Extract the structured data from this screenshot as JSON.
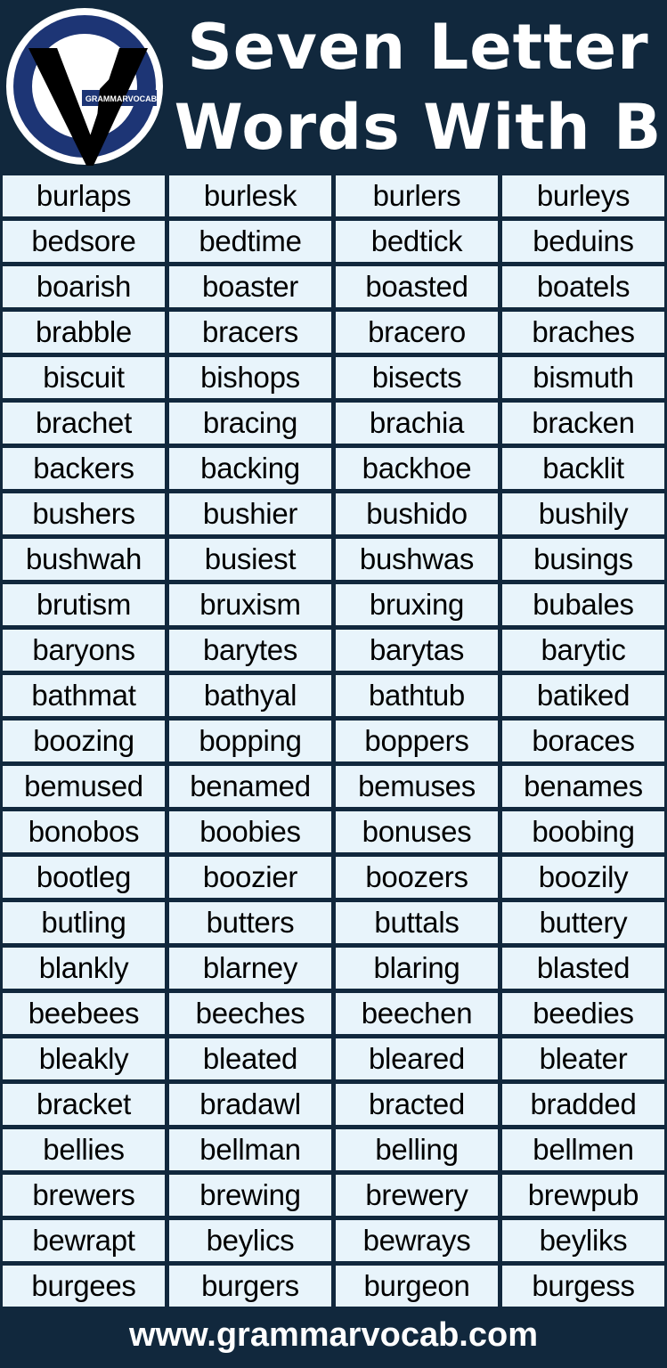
{
  "logo": {
    "text": "GRAMMARVOCAB",
    "colors": {
      "ring": "#1d3575",
      "v": "#000000",
      "bg": "#ffffff"
    }
  },
  "title": {
    "line1": "Seven Letter",
    "line2": "Words With B"
  },
  "colors": {
    "background": "#11283d",
    "cell": "#e8f4fb"
  },
  "words": [
    [
      "burlaps",
      "burlesk",
      "burlers",
      "burleys"
    ],
    [
      "bedsore",
      "bedtime",
      "bedtick",
      "beduins"
    ],
    [
      "boarish",
      "boaster",
      "boasted",
      "boatels"
    ],
    [
      "brabble",
      "bracers",
      "bracero",
      "braches"
    ],
    [
      "biscuit",
      "bishops",
      "bisects",
      "bismuth"
    ],
    [
      "brachet",
      "bracing",
      "brachia",
      "bracken"
    ],
    [
      "backers",
      "backing",
      "backhoe",
      "backlit"
    ],
    [
      "bushers",
      "bushier",
      "bushido",
      "bushily"
    ],
    [
      "bushwah",
      "busiest",
      "bushwas",
      "busings"
    ],
    [
      "brutism",
      "bruxism",
      "bruxing",
      "bubales"
    ],
    [
      "baryons",
      "barytes",
      "barytas",
      "barytic"
    ],
    [
      "bathmat",
      "bathyal",
      "bathtub",
      "batiked"
    ],
    [
      "boozing",
      "bopping",
      "boppers",
      "boraces"
    ],
    [
      "bemused",
      "benamed",
      "bemuses",
      "benames"
    ],
    [
      "bonobos",
      "boobies",
      "bonuses",
      "boobing"
    ],
    [
      "bootleg",
      "boozier",
      "boozers",
      "boozily"
    ],
    [
      "butling",
      "butters",
      "buttals",
      "buttery"
    ],
    [
      "blankly",
      "blarney",
      "blaring",
      "blasted"
    ],
    [
      "beebees",
      "beeches",
      "beechen",
      "beedies"
    ],
    [
      "bleakly",
      "bleated",
      "bleared",
      "bleater"
    ],
    [
      "bracket",
      "bradawl",
      "bracted",
      "bradded"
    ],
    [
      "bellies",
      "bellman",
      "belling",
      "bellmen"
    ],
    [
      "brewers",
      "brewing",
      "brewery",
      "brewpub"
    ],
    [
      "bewrapt",
      "beylics",
      "bewrays",
      "beyliks"
    ],
    [
      "burgees",
      "burgers",
      "burgeon",
      "burgess"
    ]
  ],
  "footer": {
    "url": "www.grammarvocab.com"
  }
}
